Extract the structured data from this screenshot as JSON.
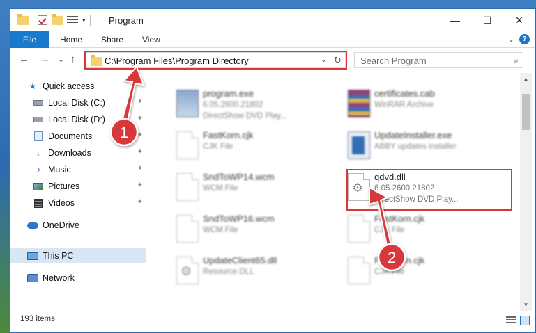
{
  "window": {
    "title": "Program",
    "controls": {
      "minimize": "—",
      "maximize": "☐",
      "close": "✕"
    }
  },
  "ribbon": {
    "tabs": [
      "File",
      "Home",
      "Share",
      "View"
    ],
    "expand": "⌄",
    "help": "?"
  },
  "nav": {
    "back": "←",
    "forward": "→",
    "recent": "⌄",
    "up": "↑"
  },
  "address": {
    "path": "C:\\Program Files\\Program Directory",
    "chevron": "⌄",
    "refresh": "↻"
  },
  "search": {
    "placeholder": "Search Program",
    "icon": "⌕"
  },
  "sidebar": {
    "items": [
      {
        "label": "Quick access",
        "icon": "star-icon"
      },
      {
        "label": "Local Disk (C:)",
        "icon": "drive-icon",
        "pinned": true
      },
      {
        "label": "Local Disk (D:)",
        "icon": "drive-icon",
        "pinned": true
      },
      {
        "label": "Documents",
        "icon": "documents-icon",
        "pinned": true
      },
      {
        "label": "Downloads",
        "icon": "downloads-icon",
        "pinned": true
      },
      {
        "label": "Music",
        "icon": "music-icon",
        "pinned": true
      },
      {
        "label": "Pictures",
        "icon": "pictures-icon",
        "pinned": true
      },
      {
        "label": "Videos",
        "icon": "videos-icon",
        "pinned": true
      },
      {
        "label": "OneDrive",
        "icon": "cloud-icon"
      },
      {
        "label": "This PC",
        "icon": "computer-icon",
        "selected": true
      },
      {
        "label": "Network",
        "icon": "network-icon"
      }
    ],
    "pin_glyph": "📌"
  },
  "files": [
    {
      "name": "program.exe",
      "line2": "6.05.2600.21802",
      "line3": "DirectShow DVD Play...",
      "icon": "exe"
    },
    {
      "name": "certificates.cab",
      "line2": "WinRAR Archive",
      "line3": "",
      "icon": "rar"
    },
    {
      "name": "FastKorn.cjk",
      "line2": "CJK File",
      "line3": "",
      "icon": "doc"
    },
    {
      "name": "UpdateInstaller.exe",
      "line2": "ABBY updates installer",
      "line3": "",
      "icon": "installer"
    },
    {
      "name": "SndToWP14.wcm",
      "line2": "WCM File",
      "line3": "",
      "icon": "doc"
    },
    {
      "name": "qdvd.dll",
      "line2": "6.05.2600.21802",
      "line3": "DirectShow DVD Play...",
      "icon": "gear"
    },
    {
      "name": "SndToWP16.wcm",
      "line2": "WCM File",
      "line3": "",
      "icon": "doc"
    },
    {
      "name": "FastKorn.cjk",
      "line2": "CJK File",
      "line3": "",
      "icon": "doc"
    },
    {
      "name": "UpdateClient65.dll",
      "line2": "Resource DLL",
      "line3": "",
      "icon": "gear"
    },
    {
      "name": "FastKorn.cjk",
      "line2": "CJK File",
      "line3": "",
      "icon": "doc"
    }
  ],
  "status": {
    "count": "193 items"
  },
  "annotations": {
    "step1": "1",
    "step2": "2",
    "color": "#d9383a"
  }
}
